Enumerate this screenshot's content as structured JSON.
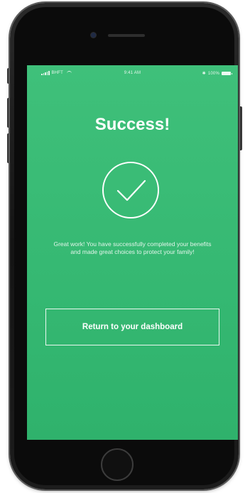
{
  "status_bar": {
    "carrier": "BHFT",
    "time": "9:41 AM",
    "battery": "100%"
  },
  "screen": {
    "title": "Success!",
    "message": "Great work! You have successfully completed your benefits and made great choices to protect your family!",
    "button_label": "Return to your dashboard"
  },
  "icons": {
    "status": "checkmark-circle-icon",
    "signal": "signal-icon",
    "wifi": "wifi-icon",
    "bluetooth": "bluetooth-icon",
    "battery": "battery-icon"
  },
  "colors": {
    "screen_bg": "#3bbd76",
    "text": "#ffffff",
    "phone_body": "#1a1a1a"
  }
}
